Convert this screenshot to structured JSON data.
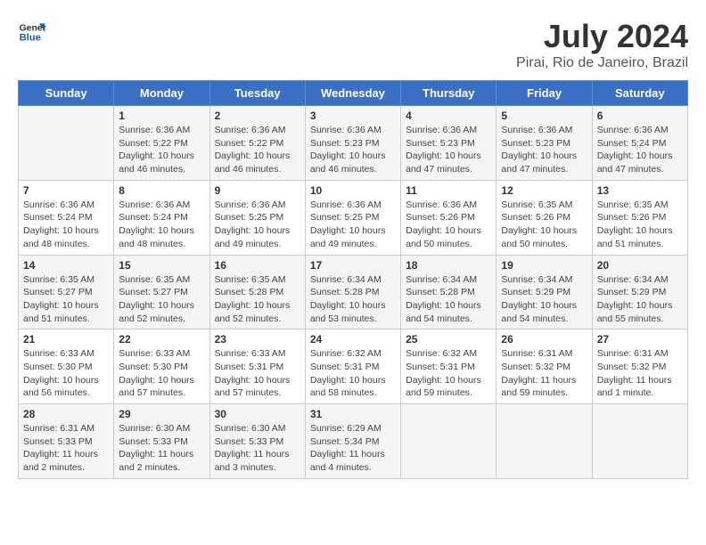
{
  "header": {
    "logo_line1": "General",
    "logo_line2": "Blue",
    "title": "July 2024",
    "subtitle": "Pirai, Rio de Janeiro, Brazil"
  },
  "days_of_week": [
    "Sunday",
    "Monday",
    "Tuesday",
    "Wednesday",
    "Thursday",
    "Friday",
    "Saturday"
  ],
  "weeks": [
    [
      {
        "day": "",
        "info": ""
      },
      {
        "day": "1",
        "info": "Sunrise: 6:36 AM\nSunset: 5:22 PM\nDaylight: 10 hours\nand 46 minutes."
      },
      {
        "day": "2",
        "info": "Sunrise: 6:36 AM\nSunset: 5:22 PM\nDaylight: 10 hours\nand 46 minutes."
      },
      {
        "day": "3",
        "info": "Sunrise: 6:36 AM\nSunset: 5:23 PM\nDaylight: 10 hours\nand 46 minutes."
      },
      {
        "day": "4",
        "info": "Sunrise: 6:36 AM\nSunset: 5:23 PM\nDaylight: 10 hours\nand 47 minutes."
      },
      {
        "day": "5",
        "info": "Sunrise: 6:36 AM\nSunset: 5:23 PM\nDaylight: 10 hours\nand 47 minutes."
      },
      {
        "day": "6",
        "info": "Sunrise: 6:36 AM\nSunset: 5:24 PM\nDaylight: 10 hours\nand 47 minutes."
      }
    ],
    [
      {
        "day": "7",
        "info": "Sunrise: 6:36 AM\nSunset: 5:24 PM\nDaylight: 10 hours\nand 48 minutes."
      },
      {
        "day": "8",
        "info": "Sunrise: 6:36 AM\nSunset: 5:24 PM\nDaylight: 10 hours\nand 48 minutes."
      },
      {
        "day": "9",
        "info": "Sunrise: 6:36 AM\nSunset: 5:25 PM\nDaylight: 10 hours\nand 49 minutes."
      },
      {
        "day": "10",
        "info": "Sunrise: 6:36 AM\nSunset: 5:25 PM\nDaylight: 10 hours\nand 49 minutes."
      },
      {
        "day": "11",
        "info": "Sunrise: 6:36 AM\nSunset: 5:26 PM\nDaylight: 10 hours\nand 50 minutes."
      },
      {
        "day": "12",
        "info": "Sunrise: 6:35 AM\nSunset: 5:26 PM\nDaylight: 10 hours\nand 50 minutes."
      },
      {
        "day": "13",
        "info": "Sunrise: 6:35 AM\nSunset: 5:26 PM\nDaylight: 10 hours\nand 51 minutes."
      }
    ],
    [
      {
        "day": "14",
        "info": "Sunrise: 6:35 AM\nSunset: 5:27 PM\nDaylight: 10 hours\nand 51 minutes."
      },
      {
        "day": "15",
        "info": "Sunrise: 6:35 AM\nSunset: 5:27 PM\nDaylight: 10 hours\nand 52 minutes."
      },
      {
        "day": "16",
        "info": "Sunrise: 6:35 AM\nSunset: 5:28 PM\nDaylight: 10 hours\nand 52 minutes."
      },
      {
        "day": "17",
        "info": "Sunrise: 6:34 AM\nSunset: 5:28 PM\nDaylight: 10 hours\nand 53 minutes."
      },
      {
        "day": "18",
        "info": "Sunrise: 6:34 AM\nSunset: 5:28 PM\nDaylight: 10 hours\nand 54 minutes."
      },
      {
        "day": "19",
        "info": "Sunrise: 6:34 AM\nSunset: 5:29 PM\nDaylight: 10 hours\nand 54 minutes."
      },
      {
        "day": "20",
        "info": "Sunrise: 6:34 AM\nSunset: 5:29 PM\nDaylight: 10 hours\nand 55 minutes."
      }
    ],
    [
      {
        "day": "21",
        "info": "Sunrise: 6:33 AM\nSunset: 5:30 PM\nDaylight: 10 hours\nand 56 minutes."
      },
      {
        "day": "22",
        "info": "Sunrise: 6:33 AM\nSunset: 5:30 PM\nDaylight: 10 hours\nand 57 minutes."
      },
      {
        "day": "23",
        "info": "Sunrise: 6:33 AM\nSunset: 5:31 PM\nDaylight: 10 hours\nand 57 minutes."
      },
      {
        "day": "24",
        "info": "Sunrise: 6:32 AM\nSunset: 5:31 PM\nDaylight: 10 hours\nand 58 minutes."
      },
      {
        "day": "25",
        "info": "Sunrise: 6:32 AM\nSunset: 5:31 PM\nDaylight: 10 hours\nand 59 minutes."
      },
      {
        "day": "26",
        "info": "Sunrise: 6:31 AM\nSunset: 5:32 PM\nDaylight: 11 hours\nand 59 minutes."
      },
      {
        "day": "27",
        "info": "Sunrise: 6:31 AM\nSunset: 5:32 PM\nDaylight: 11 hours\nand 1 minute."
      }
    ],
    [
      {
        "day": "28",
        "info": "Sunrise: 6:31 AM\nSunset: 5:33 PM\nDaylight: 11 hours\nand 2 minutes."
      },
      {
        "day": "29",
        "info": "Sunrise: 6:30 AM\nSunset: 5:33 PM\nDaylight: 11 hours\nand 2 minutes."
      },
      {
        "day": "30",
        "info": "Sunrise: 6:30 AM\nSunset: 5:33 PM\nDaylight: 11 hours\nand 3 minutes."
      },
      {
        "day": "31",
        "info": "Sunrise: 6:29 AM\nSunset: 5:34 PM\nDaylight: 11 hours\nand 4 minutes."
      },
      {
        "day": "",
        "info": ""
      },
      {
        "day": "",
        "info": ""
      },
      {
        "day": "",
        "info": ""
      }
    ]
  ]
}
